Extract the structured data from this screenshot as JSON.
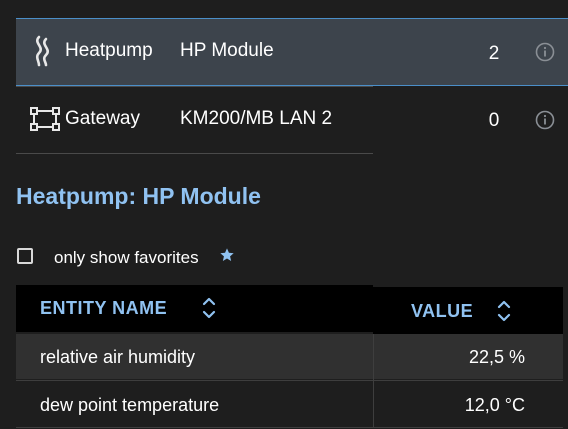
{
  "devices": [
    {
      "icon": "heatpump-icon",
      "type": "Heatpump",
      "name": "HP Module",
      "count": "2",
      "selected": true
    },
    {
      "icon": "gateway-icon",
      "type": "Gateway",
      "name": "KM200/MB LAN 2",
      "count": "0",
      "selected": false
    }
  ],
  "detail": {
    "title": "Heatpump: HP Module"
  },
  "favorites": {
    "label": "only show favorites",
    "checked": false,
    "icon": "star-icon"
  },
  "table": {
    "columns": [
      "ENTITY NAME",
      "VALUE"
    ],
    "rows": [
      {
        "name": "relative air humidity",
        "value": "22,5 %"
      },
      {
        "name": "dew point temperature",
        "value": "12,0 °C"
      }
    ]
  },
  "colors": {
    "accent": "#90c2f1",
    "selected_row": "#3d444c",
    "selected_border": "#4b8fc9",
    "background": "#1e1e1e",
    "header_bg": "#000000"
  }
}
